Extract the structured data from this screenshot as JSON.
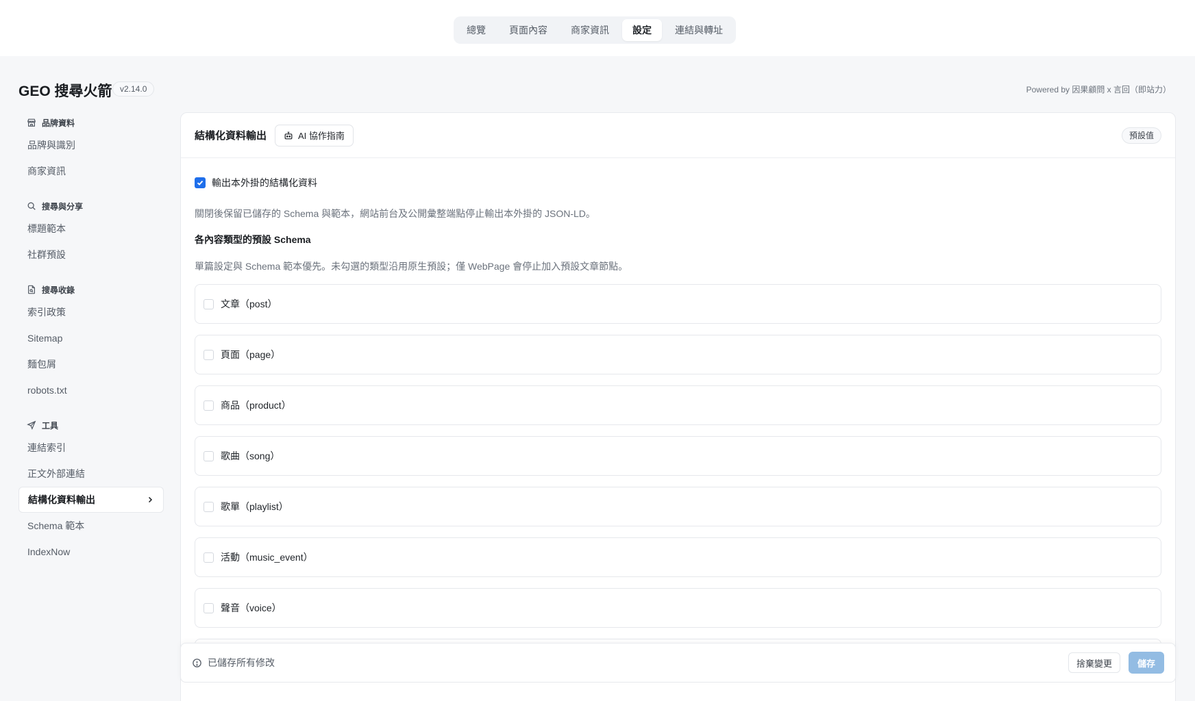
{
  "top_tabs": [
    "總覽",
    "頁面內容",
    "商家資訊",
    "設定",
    "連結與轉址"
  ],
  "active_tab_index": 3,
  "app": {
    "title": "GEO 搜尋火箭",
    "version": "v2.14.0",
    "powered_by": "Powered by 因果顧問 x 言回（即站力）"
  },
  "sidebar": {
    "brand": {
      "heading": "品牌資料",
      "icon": "store-icon",
      "items": [
        "品牌與識別",
        "商家資訊"
      ]
    },
    "search": {
      "heading": "搜尋與分享",
      "icon": "search-icon",
      "items": [
        "標題範本",
        "社群預設"
      ]
    },
    "indexing": {
      "heading": "搜尋收錄",
      "icon": "file-search-icon",
      "items": [
        "索引政策",
        "Sitemap",
        "麵包屑",
        "robots.txt"
      ]
    },
    "tools": {
      "heading": "工具",
      "icon": "send-icon",
      "items": [
        "連結索引",
        "正文外部連結",
        "結構化資料輸出",
        "Schema 範本",
        "IndexNow"
      ],
      "active_index": 2
    }
  },
  "panel": {
    "title": "結構化資料輸出",
    "ai_button": "AI 協作指南",
    "default_button": "預設值",
    "output_toggle_label": "輸出本外掛的結構化資料",
    "output_toggle_checked": true,
    "description": "關閉後保留已儲存的 Schema 與範本，網站前台及公開彙整端點停止輸出本外掛的 JSON-LD。",
    "types_heading": "各內容類型的預設 Schema",
    "types_description": "單篇設定與 Schema 範本優先。未勾選的類型沿用原生預設；僅 WebPage 會停止加入預設文章節點。",
    "types": [
      {
        "label": "文章（post）",
        "checked": false
      },
      {
        "label": "頁面（page）",
        "checked": false
      },
      {
        "label": "商品（product）",
        "checked": false
      },
      {
        "label": "歌曲（song）",
        "checked": false
      },
      {
        "label": "歌單（playlist）",
        "checked": false
      },
      {
        "label": "活動（music_event）",
        "checked": false
      },
      {
        "label": "聲音（voice）",
        "checked": false
      }
    ]
  },
  "savebar": {
    "status": "已儲存所有修改",
    "discard_label": "捨棄變更",
    "save_label": "儲存"
  },
  "colors": {
    "accent": "#1f6feb",
    "save_disabled": "#93bce3"
  }
}
